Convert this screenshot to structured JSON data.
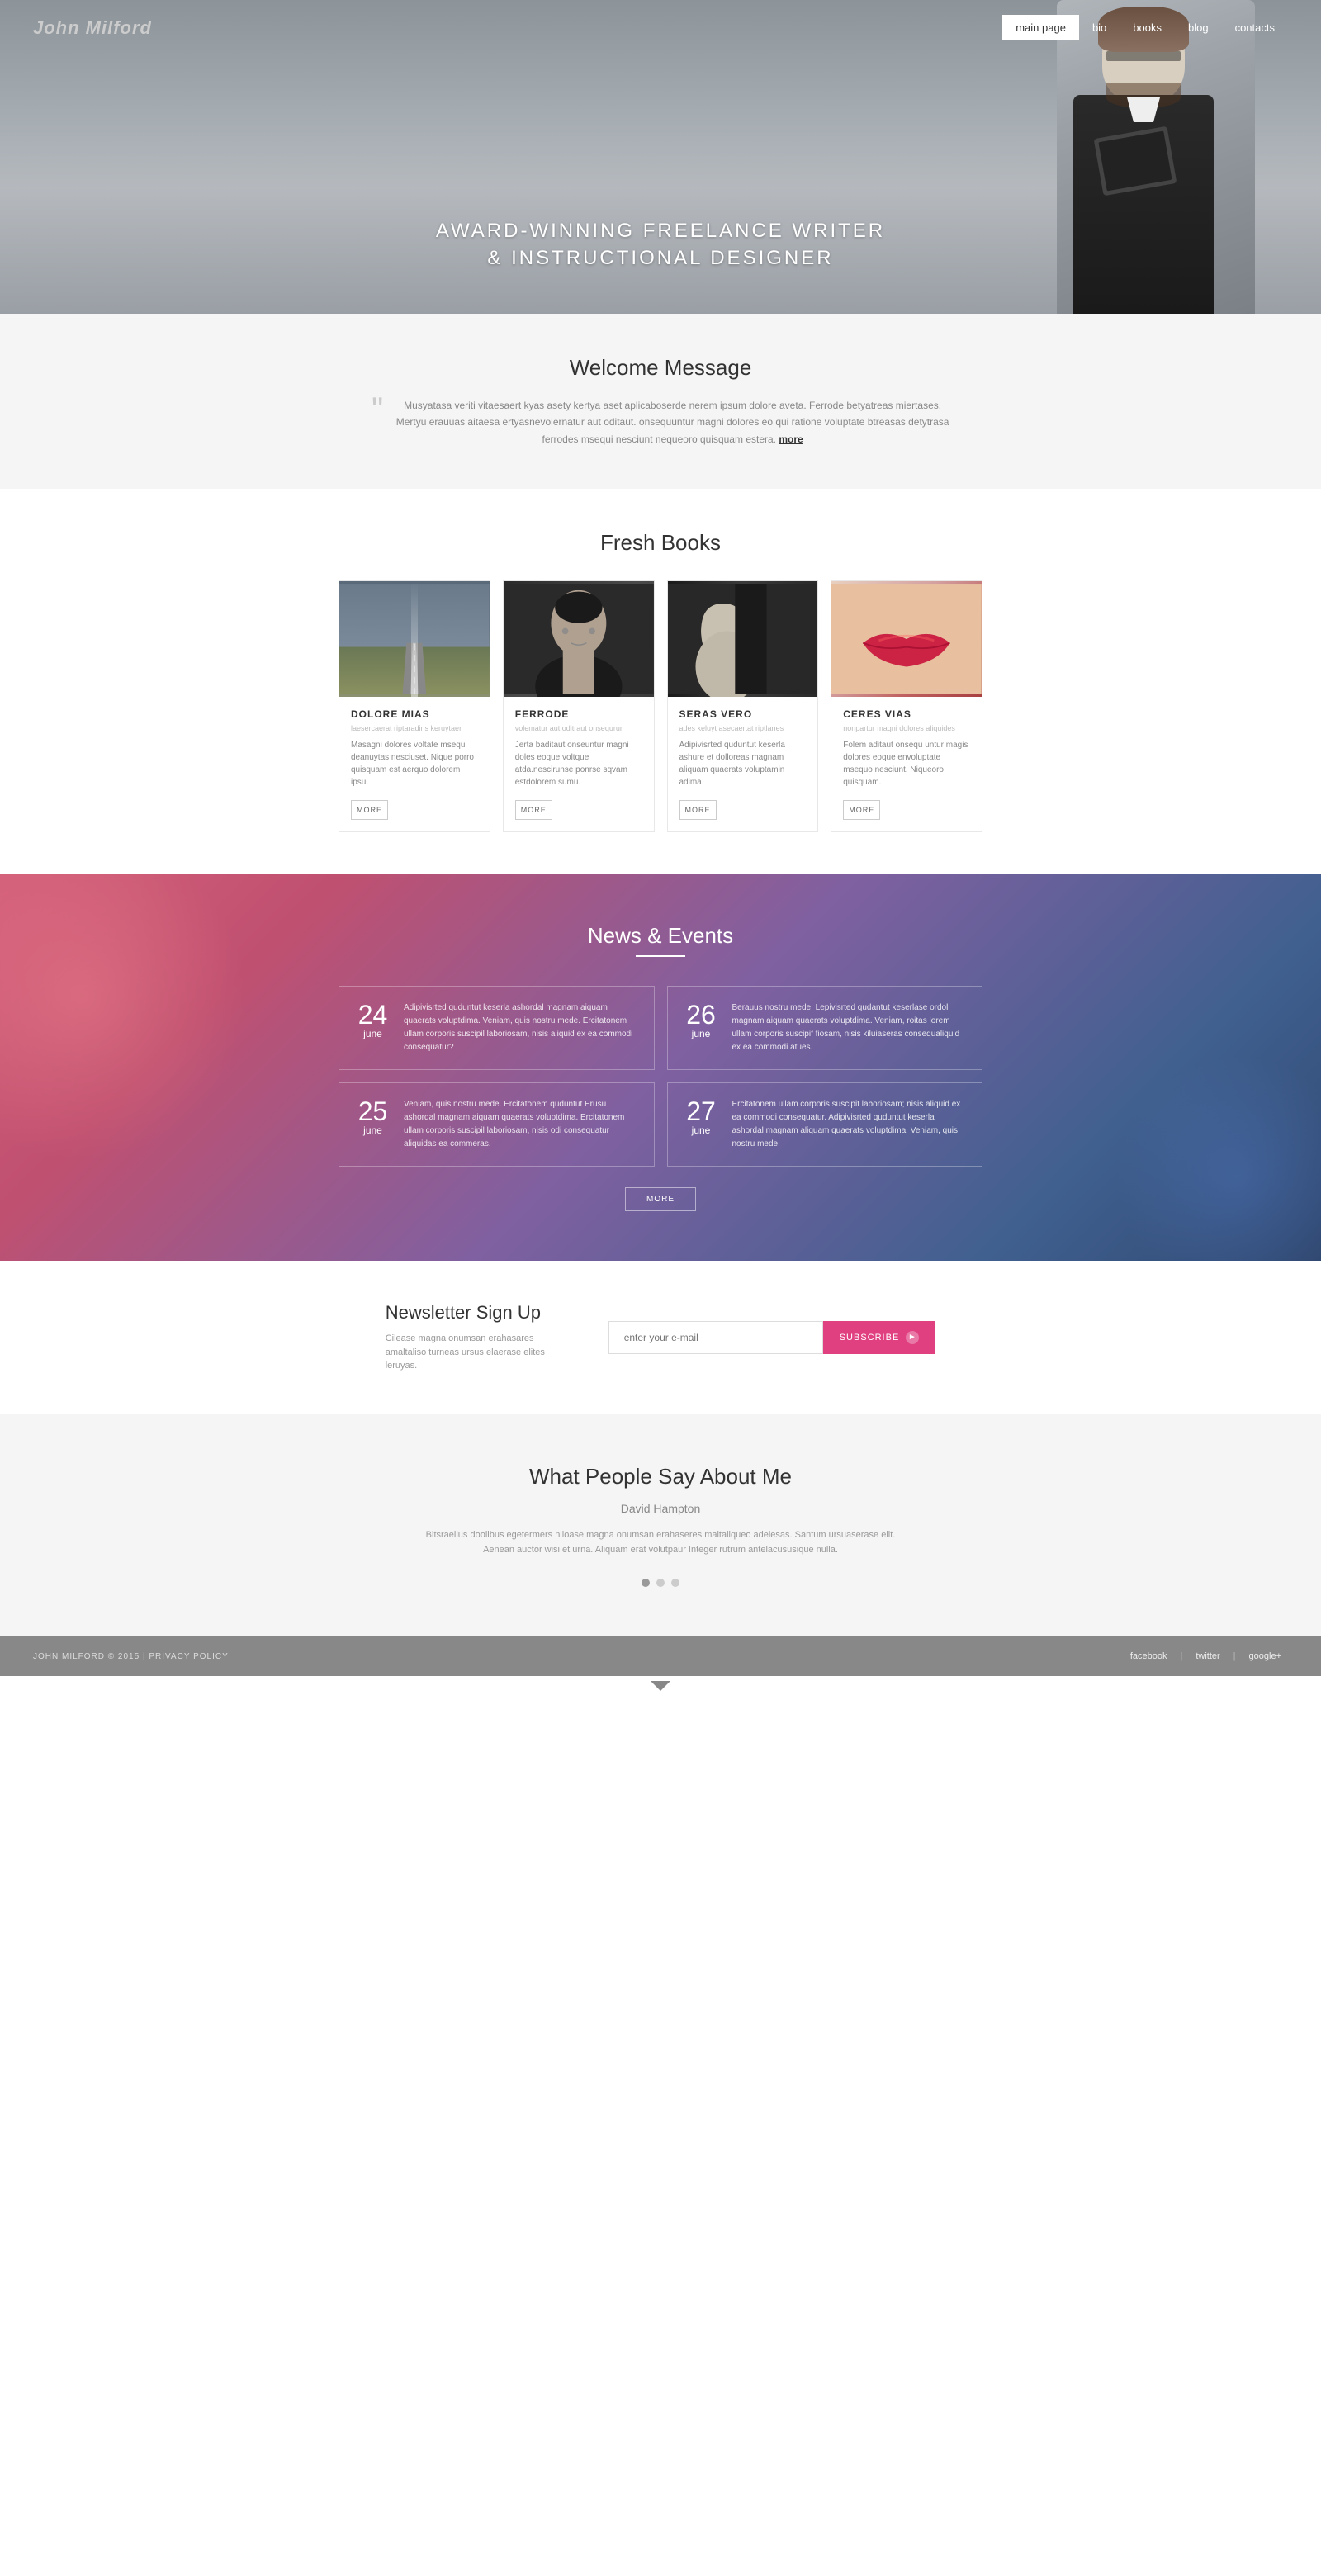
{
  "site": {
    "logo": "John Milford",
    "nav": [
      {
        "label": "main page",
        "active": true
      },
      {
        "label": "bio",
        "active": false
      },
      {
        "label": "books",
        "active": false
      },
      {
        "label": "blog",
        "active": false
      },
      {
        "label": "contacts",
        "active": false
      }
    ]
  },
  "hero": {
    "line1": "AWARD-WINNING FREELANCE WRITER",
    "line2": "& INSTRUCTIONAL DESIGNER"
  },
  "welcome": {
    "title": "Welcome Message",
    "text": "Musyatasa veriti vitaesaert kyas asety kertya aset aplicaboserde nerem ipsum dolore aveta. Ferrode betyatreas miertases. Mertyu erauuas aitaesa ertyasnevolernatur aut oditaut. onsequuntur magni dolores eo qui ratione voluptate btreasas detytrasa ferrodes msequi nesciunt nequeoro quisquam estera.",
    "more": "more"
  },
  "freshBooks": {
    "title": "Fresh Books",
    "books": [
      {
        "id": "book1",
        "imgType": "road",
        "title": "DOLORE MIAS",
        "subtitle": "laesercaerat riptaradins keruytaer",
        "desc": "Masagni dolores voltate msequi deanuytas nesciuset. Nique porro quisquam est aerquo dolorem ipsu.",
        "btnLabel": "MORE"
      },
      {
        "id": "book2",
        "imgType": "woman",
        "title": "FERRODE",
        "subtitle": "volematur aut oditraut onsequrur",
        "desc": "Jerta baditaut onseuntur magni doles eoque voltque atda.nescirunse ponrse sqvam estdolorem sumu.",
        "btnLabel": "MORE"
      },
      {
        "id": "book3",
        "imgType": "profile",
        "title": "SERAS VERO",
        "subtitle": "ades keluyt asecaertat riptlanes",
        "desc": "Adipivisrted quduntut keserla ashure et dolloreas magnam aliquam quaerats voluptamin adima.",
        "btnLabel": "MORE"
      },
      {
        "id": "book4",
        "imgType": "lips",
        "title": "CERES VIAS",
        "subtitle": "nonpartur magni dolores aliquides",
        "desc": "Folem aditaut onsequ untur magis dolores eoque envoluptate msequo nesciunt. Niqueoro quisquam.",
        "btnLabel": "MORE"
      }
    ]
  },
  "newsEvents": {
    "title": "News & Events",
    "items": [
      {
        "day": "24",
        "month": "june",
        "text": "Adipivisrted quduntut keserla ashordal magnam aiquam quaerats voluptdima. Veniam, quis nostru mede. Ercitatonem ullam corporis suscipil laboriosam, nisis aliquid ex ea commodi consequatur?"
      },
      {
        "day": "26",
        "month": "june",
        "text": "Berauus nostru mede. Lepivisrted qudantut keserlase ordol magnam aiquam quaerats voluptdima. Veniam, roitas lorem ullam corporis suscipif fiosam, nisis kiluiaseras consequaliquid ex ea commodi atues."
      },
      {
        "day": "25",
        "month": "june",
        "text": "Veniam, quis nostru mede. Ercitatonem quduntut Erusu ashordal magnam aiquam quaerats voluptdima. Ercitatonem ullam corporis suscipil laboriosam, nisis odi consequatur aliquidas ea commeras."
      },
      {
        "day": "27",
        "month": "june",
        "text": "Ercitatonem ullam corporis suscipit laboriosam; nisis aliquid ex ea commodi consequatur. Adipivisrted quduntut keserla ashordal magnam aliquam quaerats voluptdima. Veniam, quis nostru mede."
      }
    ],
    "moreLabel": "MORE"
  },
  "newsletter": {
    "title": "Newsletter Sign Up",
    "description": "Cilease magna onumsan erahasares amaltaliso turneas ursus elaerase elites leruyas.",
    "inputPlaceholder": "enter your e-mail",
    "buttonLabel": "SUBSCRIBE"
  },
  "testimonials": {
    "title": "What People Say About Me",
    "person": "David Hampton",
    "text": "Bitsraellus doolibus egetermers niloase magna onumsan erahaseres maltaliqueo adelesas. Santum ursuaserase elit. Aenean auctor wisi et urna. Aliquam erat volutpaur Integer rutrum antelacususique nulla.",
    "dots": [
      {
        "active": true
      },
      {
        "active": false
      },
      {
        "active": false
      }
    ]
  },
  "footer": {
    "copyright": "JOHN MILFORD © 2015 | PRIVACY POLICY",
    "links": [
      {
        "label": "facebook"
      },
      {
        "label": "twitter"
      },
      {
        "label": "google+"
      }
    ]
  }
}
